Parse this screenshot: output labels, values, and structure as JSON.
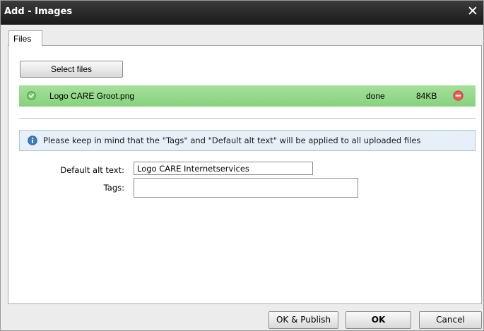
{
  "dialog": {
    "title": "Add - Images",
    "close_icon": "close-icon"
  },
  "tabs": [
    {
      "label": "Files",
      "active": true
    }
  ],
  "files_panel": {
    "select_files_label": "Select files",
    "uploads": [
      {
        "name": "Logo CARE Groot.png",
        "status": "done",
        "size": "84KB",
        "status_icon": "check-circle-icon",
        "remove_icon": "remove-circle-icon",
        "row_color": "#95d98a"
      }
    ],
    "info_icon": "info-icon",
    "info_message": "Please keep in mind that the \"Tags\" and \"Default alt text\" will be applied to all uploaded files",
    "default_alt_text": {
      "label": "Default alt text:",
      "value": "Logo CARE Internetservices"
    },
    "tags": {
      "label": "Tags:",
      "value": ""
    }
  },
  "footer": {
    "ok_publish_label": "OK & Publish",
    "ok_label": "OK",
    "cancel_label": "Cancel"
  }
}
